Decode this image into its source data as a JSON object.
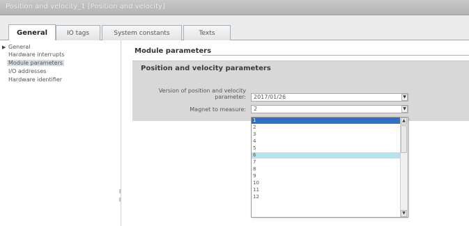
{
  "window": {
    "title": "Position and velocity_1 [Position and velocity]"
  },
  "tabs": [
    {
      "label": "General",
      "active": true
    },
    {
      "label": "IO tags",
      "active": false
    },
    {
      "label": "System constants",
      "active": false
    },
    {
      "label": "Texts",
      "active": false
    }
  ],
  "nav": {
    "items": [
      "General",
      "Hardware interrupts",
      "Module parameters",
      "I/O addresses",
      "Hardware identifier"
    ],
    "selected": "Module parameters"
  },
  "main": {
    "section_title": "Module parameters",
    "group_title": "Position and velocity parameters",
    "version_label": "Version of position and velocity parameter:",
    "version_value": "2017/01/26",
    "magnet_label": "Magnet to measure:",
    "magnet_value": "2"
  },
  "dropdown": {
    "options": [
      "1",
      "2",
      "3",
      "4",
      "5",
      "6",
      "7",
      "8",
      "9",
      "10",
      "11",
      "12"
    ],
    "selected": "1",
    "hover": "6"
  },
  "colors": {
    "selected": "#2f6fc4",
    "hover": "#b7e3f0",
    "group_bg": "#d8d8d8"
  }
}
